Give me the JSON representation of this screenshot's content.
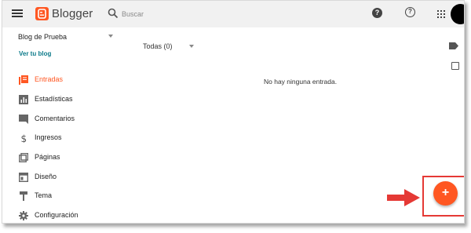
{
  "header": {
    "brand": "Blogger",
    "search_placeholder": "Buscar"
  },
  "sidebar": {
    "blog_name": "Blog de Prueba",
    "view_blog": "Ver tu blog",
    "items": [
      {
        "label": "Entradas",
        "icon": "posts-icon",
        "active": true
      },
      {
        "label": "Estadísticas",
        "icon": "stats-icon",
        "active": false
      },
      {
        "label": "Comentarios",
        "icon": "comment-icon",
        "active": false
      },
      {
        "label": "Ingresos",
        "icon": "dollar-icon",
        "active": false
      },
      {
        "label": "Páginas",
        "icon": "pages-icon",
        "active": false
      },
      {
        "label": "Diseño",
        "icon": "layout-icon",
        "active": false
      },
      {
        "label": "Tema",
        "icon": "paint-roller-icon",
        "active": false
      },
      {
        "label": "Configuración",
        "icon": "gear-icon",
        "active": false
      }
    ]
  },
  "main": {
    "filter": "Todas (0)",
    "empty_message": "No hay ninguna entrada."
  },
  "fab": {
    "label": "+"
  },
  "colors": {
    "accent": "#ff5722",
    "topbar": "#f1f1f1",
    "link": "#0c7a8a",
    "annotation": "#e53935"
  }
}
